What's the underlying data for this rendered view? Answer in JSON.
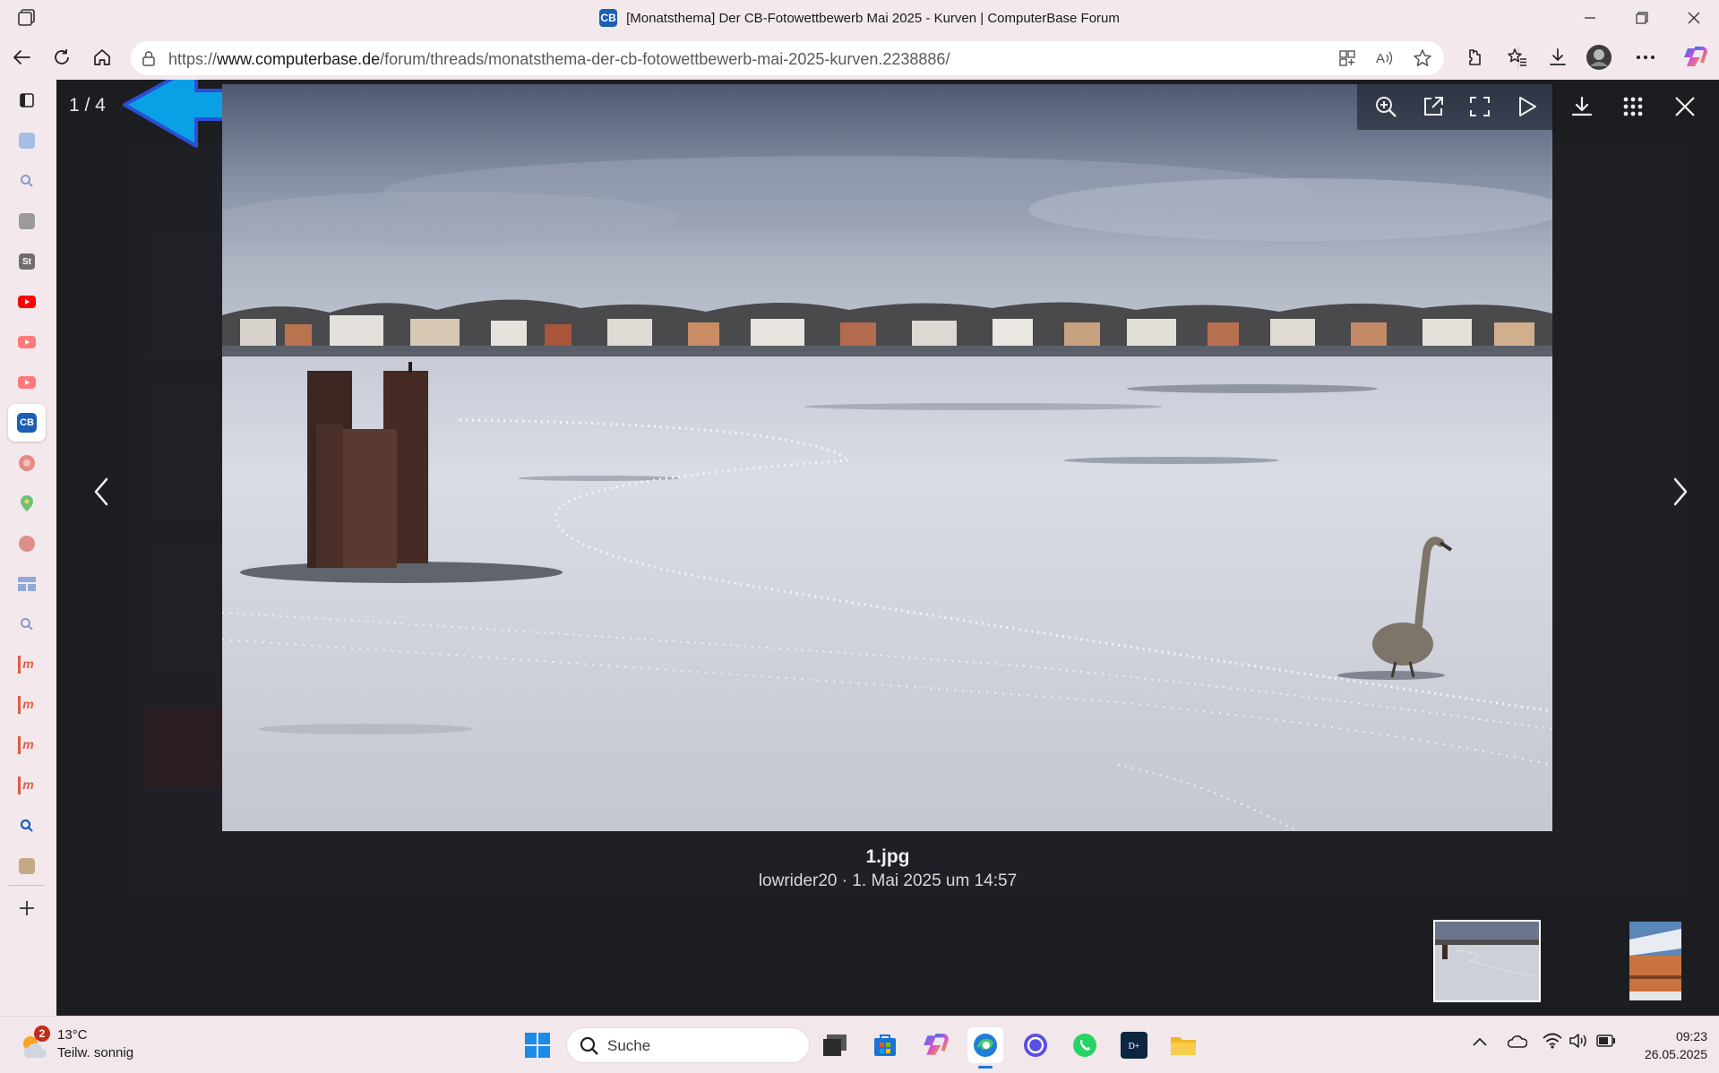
{
  "browser": {
    "window_title": "[Monatsthema] Der CB-Fotowettbewerb Mai 2025 - Kurven | ComputerBase Forum",
    "favicon_text": "CB",
    "url_protocol": "https://",
    "url_domain": "www.computerbase.de",
    "url_path": "/forum/threads/monatsthema-der-cb-fotowettbewerb-mai-2025-kurven.2238886/",
    "toolbar_icons": [
      "back-icon",
      "reload-icon",
      "home-icon",
      "lock-icon",
      "app-available-icon",
      "read-aloud-icon",
      "favorite-star-icon",
      "extensions-icon",
      "favorites-icon",
      "downloads-icon",
      "profile-avatar",
      "more-icon",
      "copilot-icon"
    ]
  },
  "sidebar": {
    "items": [
      {
        "name": "tab-actions-icon",
        "color": "#3a3a3a"
      },
      {
        "name": "translator-icon",
        "color": "#8aa6d8"
      },
      {
        "name": "search-icon",
        "color": "#8a9ac8"
      },
      {
        "name": "app-grey-icon",
        "color": "#8c8c8c"
      },
      {
        "name": "st-app-icon",
        "color": "#6b6b6b",
        "label": "St"
      },
      {
        "name": "youtube-icon",
        "color": "#ff0000"
      },
      {
        "name": "youtube-icon-2",
        "color": "#ff6b6b"
      },
      {
        "name": "youtube-icon-3",
        "color": "#ff6b6b"
      },
      {
        "name": "computerbase-icon",
        "color": "#1b5fb4",
        "label": "CB"
      },
      {
        "name": "chrome-like-icon",
        "color": "#e0736b"
      },
      {
        "name": "maps-icon",
        "color": "#58b368"
      },
      {
        "name": "app-red-icon",
        "color": "#d5736d"
      },
      {
        "name": "app-blue-icon",
        "color": "#7f9bd0"
      },
      {
        "name": "search-icon-2",
        "color": "#8a9ac8"
      },
      {
        "name": "m-app-icon",
        "color": "#d9503f",
        "label": "m"
      },
      {
        "name": "m-app-icon-2",
        "color": "#d9503f",
        "label": "m"
      },
      {
        "name": "m-app-icon-3",
        "color": "#d9503f",
        "label": "m"
      },
      {
        "name": "m-app-icon-4",
        "color": "#d9503f",
        "label": "m"
      },
      {
        "name": "search-icon-3",
        "color": "#1b5fb4"
      },
      {
        "name": "app-brown-icon",
        "color": "#b89c7a"
      },
      {
        "name": "add-icon",
        "color": "#3a3a3a"
      }
    ]
  },
  "viewer": {
    "counter": "1 / 4",
    "caption_title": "1.jpg",
    "caption_sub": "lowrider20 · 1. Mai 2025 um 14:57",
    "tools": [
      "zoom-in-icon",
      "open-external-icon",
      "fullscreen-icon",
      "slideshow-play-icon",
      "download-icon",
      "grid-icon",
      "close-icon"
    ],
    "accent_arrow_color": "#0aa0e6"
  },
  "taskbar": {
    "weather_temp": "13°C",
    "weather_cond": "Teilw. sonnig",
    "weather_badge": "2",
    "search_label": "Suche",
    "apps": [
      "start-icon",
      "file-explorer-app-icon",
      "store-icon",
      "copilot-app-icon",
      "edge-icon",
      "messenger-icon",
      "whatsapp-icon",
      "disney-plus-icon",
      "folder-icon"
    ],
    "time": "09:23",
    "date": "26.05.2025"
  }
}
